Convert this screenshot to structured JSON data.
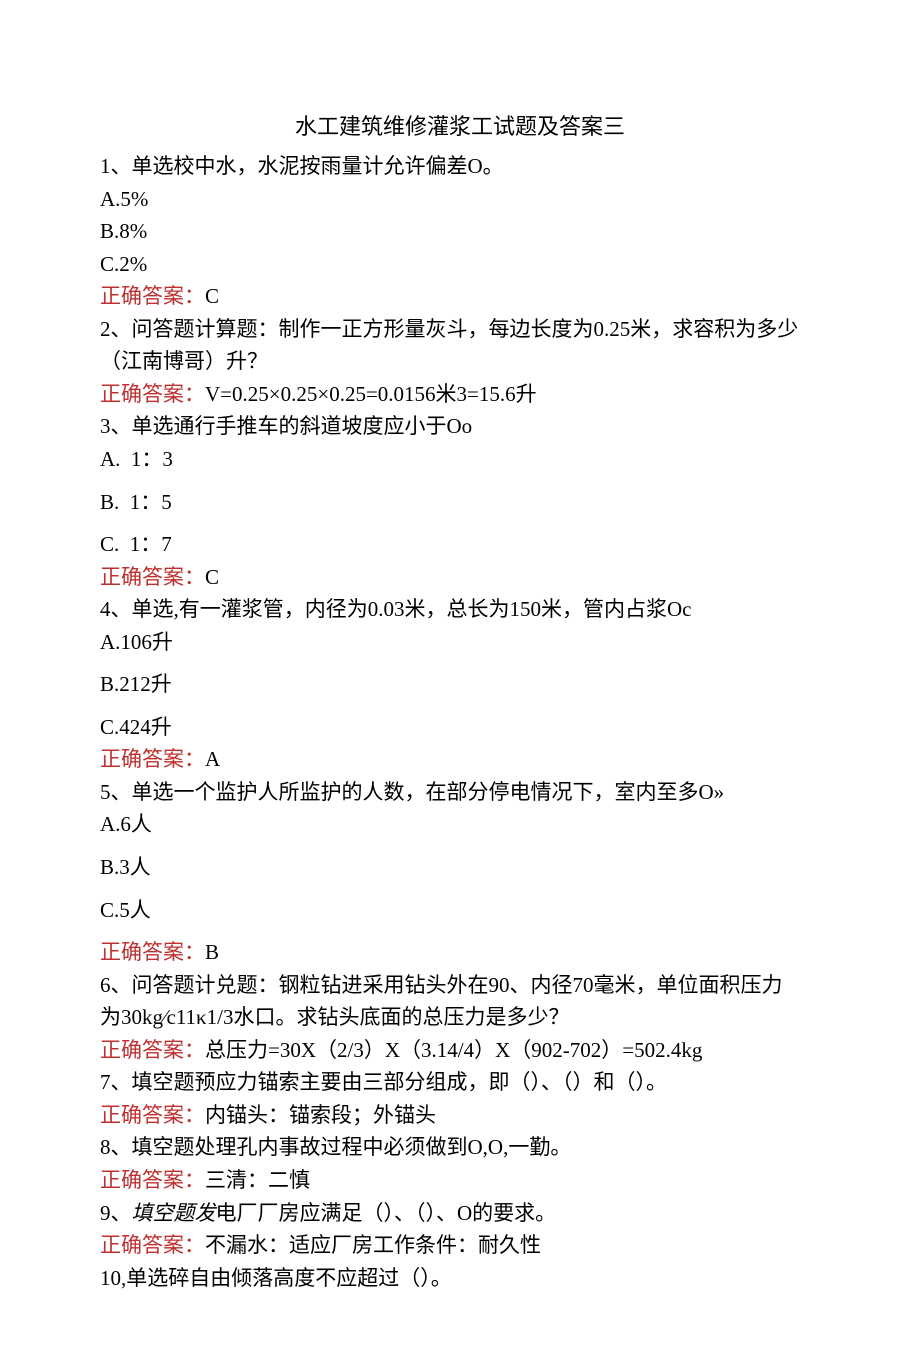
{
  "title": "水工建筑维修灌浆工试题及答案三",
  "answerLabel": "正确答案：",
  "q1": {
    "stem": "1、单选校中水，水泥按雨量计允许偏差O。",
    "optA": "A.5%",
    "optB": "B.8%",
    "optC": "C.2%",
    "ans": "C"
  },
  "q2": {
    "stem1": "2、问答题计算题：制作一正方形量灰斗，每边长度为0.25米，求容积为多少",
    "stem2": "（江南博哥）升？",
    "ans": "V=0.25×0.25×0.25=0.0156米3=15.6升"
  },
  "q3": {
    "stem": "3、单选通行手推车的斜道坡度应小于Oo",
    "optA": "A.  1：3",
    "optB": "B.  1：5",
    "optC": "C.  1：7",
    "ans": "C"
  },
  "q4": {
    "stem": "4、单选,有一灌浆管，内径为0.03米，总长为150米，管内占浆Oc",
    "optA": "A.106升",
    "optB": "B.212升",
    "optC": "C.424升",
    "ans": "A"
  },
  "q5": {
    "stem": "5、单选一个监护人所监护的人数，在部分停电情况下，室内至多O»",
    "optA": "A.6人",
    "optB": "B.3人",
    "optC": "C.5人",
    "ans": "B"
  },
  "q6": {
    "stem1": "6、问答题计兑题：钢粒钻进采用钻头外在90、内径70毫米，单位面积压力",
    "stem2": "为30kg⁄c11κ1/3水口。求钻头底面的总压力是多少？",
    "ans": "总压力=30X（2/3）X（3.14/4）X（902-702）=502.4kg"
  },
  "q7": {
    "stem": "7、填空题预应力锚索主要由三部分组成，即（）、（）和（）。",
    "ans": "内锚头：锚索段；外锚头"
  },
  "q8": {
    "stem": "8、填空题处理孔内事故过程中必须做到O,O,一勤。",
    "ans": "三清：二慎"
  },
  "q9": {
    "stemPrefix": "9、",
    "stemItalic": "填空题发",
    "stemRest": "电厂厂房应满足（）、（）、O的要求。",
    "ans": "不漏水：适应厂房工作条件：耐久性"
  },
  "q10": {
    "stem": "10,单选碎自由倾落高度不应超过（）。"
  }
}
